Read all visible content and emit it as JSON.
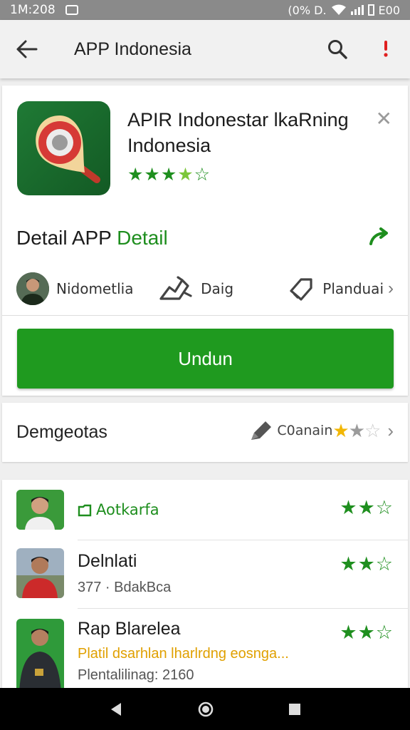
{
  "status_bar": {
    "time": "1M:208",
    "right_text": "(0% D.",
    "battery_text": "E00"
  },
  "app_bar": {
    "title": "APP Indonesia",
    "icons": [
      "back-arrow-icon",
      "search-icon",
      "overflow-menu-icon"
    ]
  },
  "app": {
    "title": "APIR Indonestar lkaRning Indonesia",
    "rating_stars": "★★★★☆",
    "detail_prefix": "Detail APP",
    "detail_link": "Detail",
    "meta": [
      {
        "icon": "developer-avatar",
        "label": "Nidometlia"
      },
      {
        "icon": "puzzle-icon",
        "label": "Daig"
      },
      {
        "icon": "tag-icon",
        "label": "Planduai"
      }
    ],
    "install_label": "Undun"
  },
  "section": {
    "label": "Demgeotas",
    "right_label": "C0anain"
  },
  "list": [
    {
      "name": "Aotkarfa",
      "sub": "",
      "stars": "★★☆"
    },
    {
      "name": "Delnlati",
      "sub": "377 · BdakBca",
      "stars": "★★☆"
    },
    {
      "name": "Rap Blarelea",
      "sub": "Platil dsarhlan lharlrdng eosnga...",
      "sub2": "Plentalilinag: 2160",
      "stars": "★★☆"
    }
  ],
  "colors": {
    "accent_green": "#1f9a1f",
    "star_green": "#1f8f1f",
    "star_yellow": "#f2b705"
  }
}
